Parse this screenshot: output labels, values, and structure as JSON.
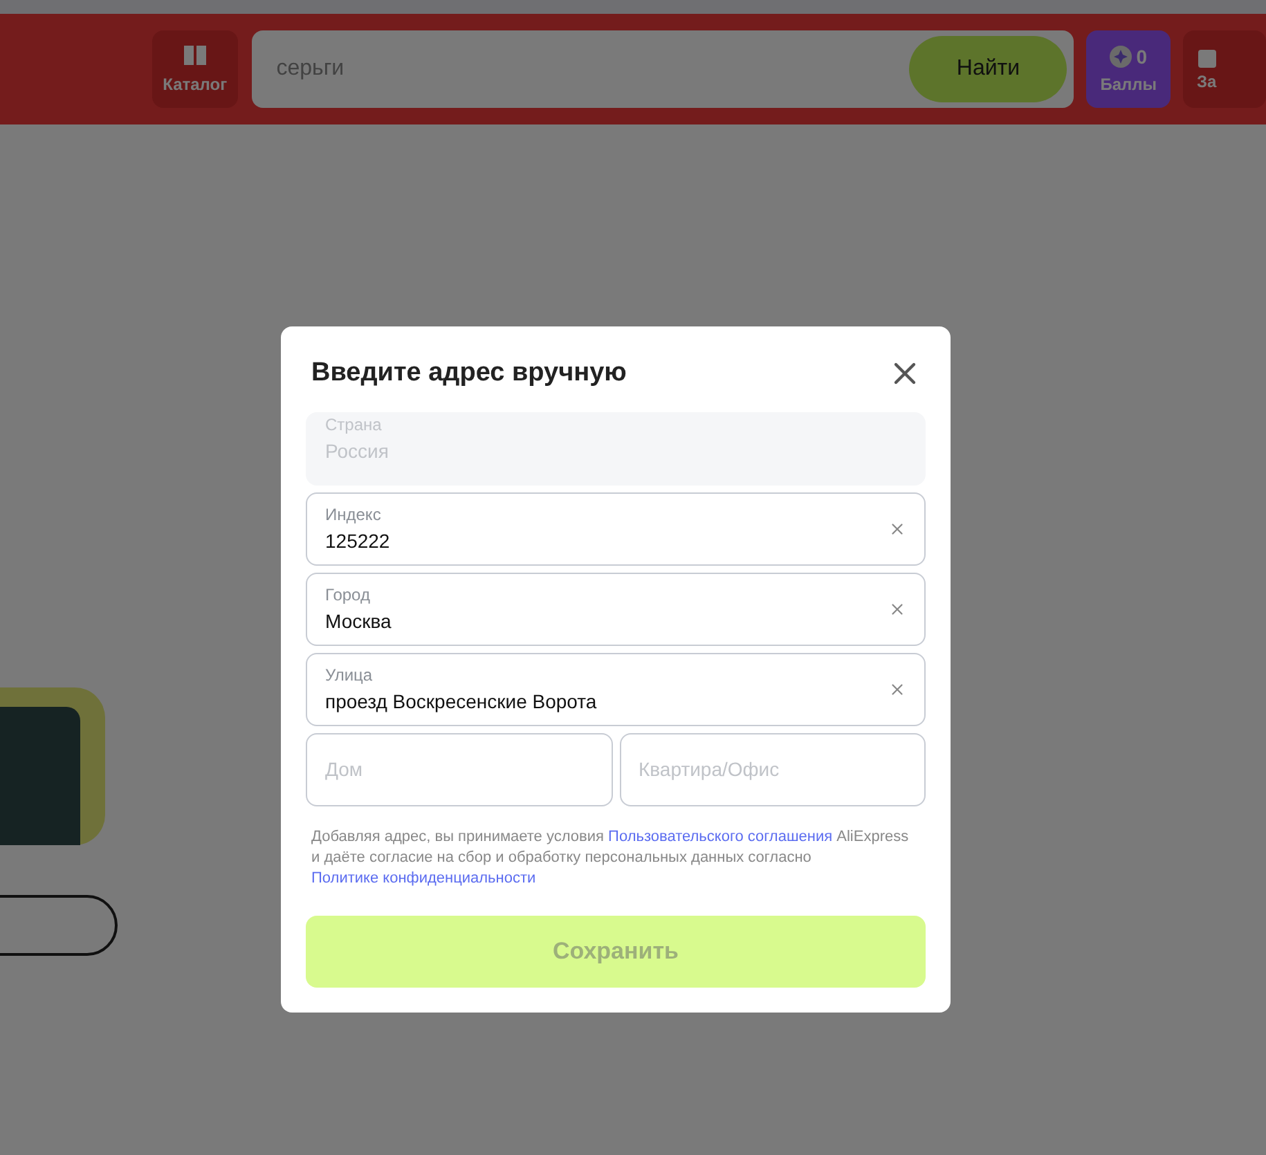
{
  "header": {
    "catalog": {
      "label": "Каталог"
    },
    "search": {
      "placeholder": "серьги",
      "button": "Найти"
    },
    "points": {
      "count": "0",
      "label": "Баллы"
    },
    "cut_button": {
      "label": "За"
    }
  },
  "dialog": {
    "title": "Введите адрес вручную",
    "fields": [
      {
        "label": "Страна",
        "value": "Россия",
        "disabled": true
      },
      {
        "label": "Индекс",
        "value": "125222",
        "disabled": false
      },
      {
        "label": "Город",
        "value": "Москва",
        "disabled": false
      },
      {
        "label": "Улица",
        "value": "проезд Воскресенские Ворота",
        "disabled": false
      }
    ],
    "half_fields": [
      {
        "placeholder": "Дом"
      },
      {
        "placeholder": "Квартира/Офис"
      }
    ],
    "consent": {
      "text_1": "Добавляя адрес, вы принимаете условия",
      "link_1": "Пользовательского соглашения",
      "text_2": "AliExpress и даёте согласие на сбор и обработку персональных данных согласно",
      "link_2": "Политике конфиденциальности"
    },
    "save": {
      "label": "Сохранить",
      "disabled": true
    }
  }
}
